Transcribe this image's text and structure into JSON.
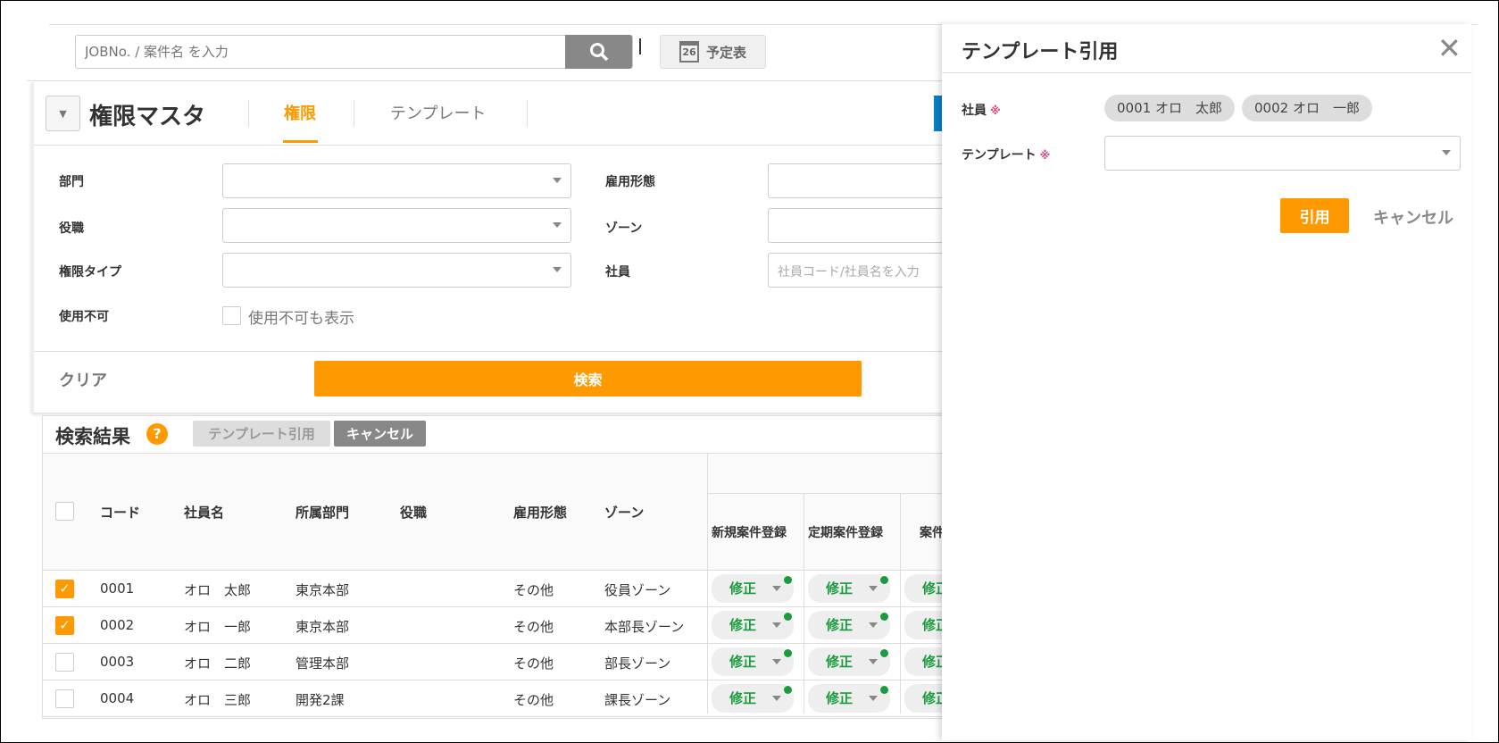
{
  "topbar": {
    "search_placeholder": "JOBNo. / 案件名 を入力",
    "calendar_day": "26",
    "schedule_label": "予定表"
  },
  "page": {
    "title": "権限マスタ",
    "tabs": [
      {
        "label": "権限",
        "active": true
      },
      {
        "label": "テンプレート",
        "active": false
      }
    ]
  },
  "filters": {
    "department_label": "部門",
    "employment_label": "雇用形態",
    "position_label": "役職",
    "zone_label": "ゾーン",
    "auth_type_label": "権限タイプ",
    "employee_label": "社員",
    "employee_placeholder": "社員コード/社員名を入力",
    "disabled_label": "使用不可",
    "disabled_checkbox_label": "使用不可も表示",
    "clear_label": "クリア",
    "search_label": "検索"
  },
  "results": {
    "title": "検索結果",
    "template_button": "テンプレート引用",
    "cancel_button": "キャンセル",
    "columns": [
      "コード",
      "社員名",
      "所属部門",
      "役職",
      "雇用形態",
      "ゾーン",
      "新規案件登録",
      "定期案件登録",
      "案件"
    ],
    "rows": [
      {
        "checked": true,
        "code": "0001",
        "name": "オロ　太郎",
        "dept": "東京本部",
        "position": "",
        "employment": "その他",
        "zone": "役員ゾーン",
        "perm": "修正"
      },
      {
        "checked": true,
        "code": "0002",
        "name": "オロ　一郎",
        "dept": "東京本部",
        "position": "",
        "employment": "その他",
        "zone": "本部長ゾーン",
        "perm": "修正"
      },
      {
        "checked": false,
        "code": "0003",
        "name": "オロ　二郎",
        "dept": "管理本部",
        "position": "",
        "employment": "その他",
        "zone": "部長ゾーン",
        "perm": "修正"
      },
      {
        "checked": false,
        "code": "0004",
        "name": "オロ　三郎",
        "dept": "開発2課",
        "position": "",
        "employment": "その他",
        "zone": "課長ゾーン",
        "perm": "修正"
      }
    ]
  },
  "dialog": {
    "title": "テンプレート引用",
    "employee_label": "社員",
    "template_label": "テンプレート",
    "required_mark": "※",
    "chips": [
      "0001 オロ　太郎",
      "0002 オロ　一郎"
    ],
    "apply_button": "引用",
    "cancel_button": "キャンセル"
  },
  "colors": {
    "accent": "#ff9900",
    "success": "#1a9c3e"
  }
}
